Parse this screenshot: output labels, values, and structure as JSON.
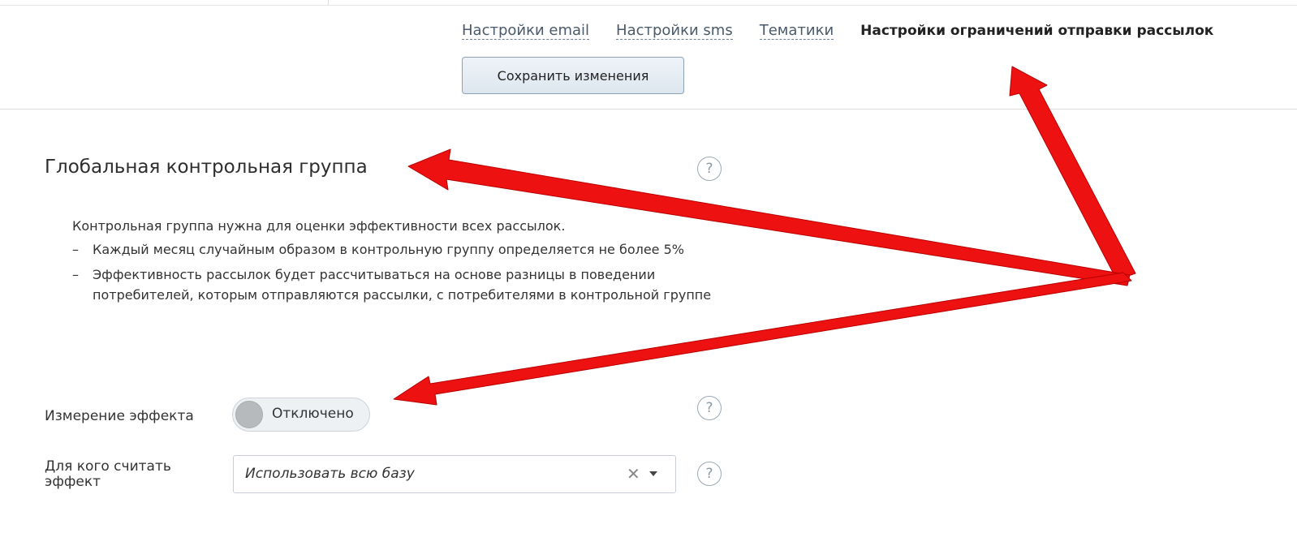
{
  "tabs": [
    {
      "label": "Настройки email"
    },
    {
      "label": "Настройки sms"
    },
    {
      "label": "Тематики"
    },
    {
      "label": "Настройки ограничений отправки рассылок"
    }
  ],
  "save_button": {
    "label": "Сохранить изменения"
  },
  "section": {
    "title": "Глобальная контрольная группа",
    "description": {
      "intro": "Контрольная группа нужна для оценки эффективности всех рассылок.",
      "items": [
        "Каждый месяц случайным образом в контрольную группу определяется не более 5%",
        "Эффективность рассылок будет рассчитываться на основе разницы в поведении потребителей, которым отправляются рассылки, с потребителями в контрольной группе"
      ],
      "dash": "–"
    }
  },
  "effect_measurement": {
    "label": "Измерение эффекта",
    "toggle_label": "Отключено"
  },
  "effect_target": {
    "label": "Для кого считать эффект",
    "value": "Использовать всю базу",
    "clear_symbol": "✕"
  },
  "help_symbol": "?",
  "colors": {
    "annotation_arrow": "#ee1111",
    "active_tab_text": "#222222",
    "tab_link": "#4a5a6a"
  },
  "icons": {
    "help": "help-icon",
    "clear": "close-icon",
    "caret": "chevron-down-icon"
  }
}
